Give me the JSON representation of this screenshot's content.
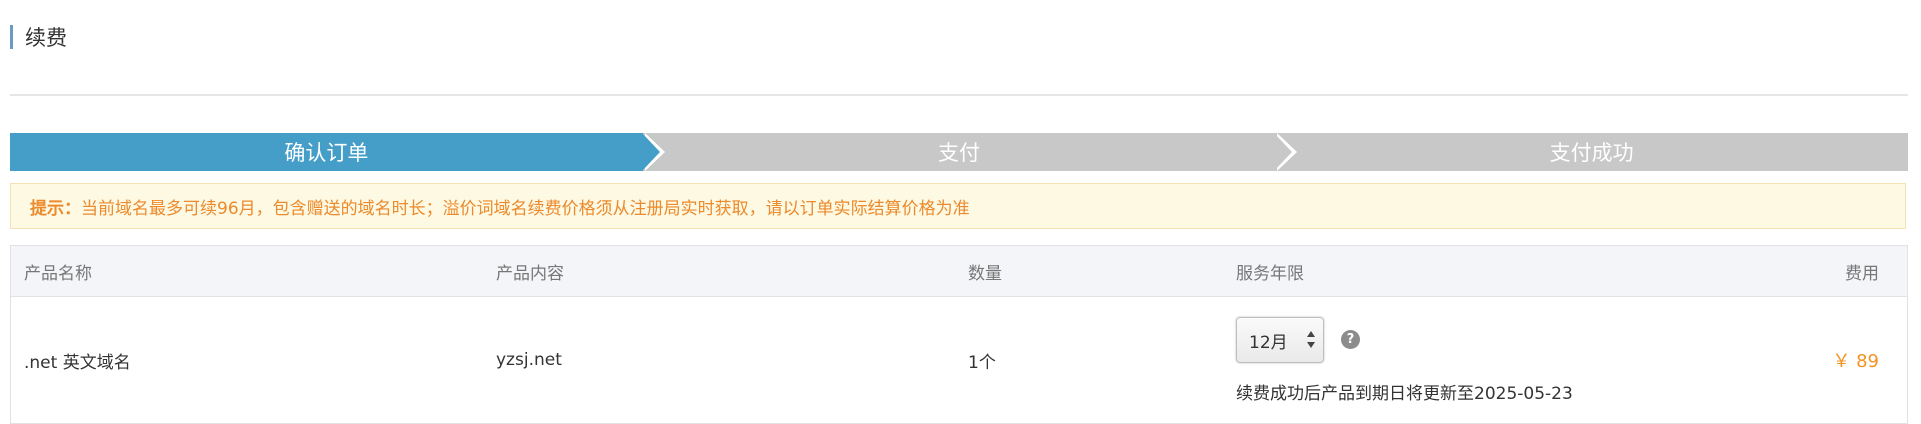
{
  "page": {
    "title": "续费"
  },
  "steps": [
    {
      "label": "确认订单",
      "active": true
    },
    {
      "label": "支付",
      "active": false
    },
    {
      "label": "支付成功",
      "active": false
    }
  ],
  "notice": {
    "label": "提示：",
    "text": "当前域名最多可续96月，包含赠送的域名时长；溢价词域名续费价格须从注册局实时获取，请以订单实际结算价格为准"
  },
  "table": {
    "columns": [
      "产品名称",
      "产品内容",
      "数量",
      "服务年限",
      "费用"
    ],
    "row": {
      "product_name": ".net 英文域名",
      "product_content": "yzsj.net",
      "quantity": "1个",
      "term_selected": "12月",
      "expire_note": "续费成功后产品到期日将更新至2025-05-23",
      "price": "￥ 89"
    }
  },
  "colors": {
    "step_active": "#449ec8",
    "step_inactive": "#c8c8c8",
    "notice_text": "#ec8a2c",
    "price": "#f39422"
  },
  "icons": {
    "help": "question-circle-icon"
  }
}
